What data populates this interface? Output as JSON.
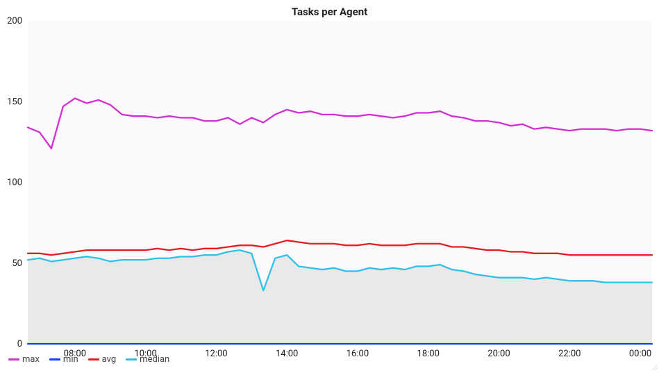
{
  "chart_data": {
    "type": "line",
    "title": "Tasks per Agent",
    "xlabel": "",
    "ylabel": "",
    "ylim": [
      0,
      200
    ],
    "yticks": [
      0,
      50,
      100,
      150,
      200
    ],
    "x": [
      "06:40",
      "07:00",
      "07:20",
      "07:40",
      "08:00",
      "08:20",
      "08:40",
      "09:00",
      "09:20",
      "09:40",
      "10:00",
      "10:20",
      "10:40",
      "11:00",
      "11:20",
      "11:40",
      "12:00",
      "12:20",
      "12:40",
      "13:00",
      "13:20",
      "13:40",
      "14:00",
      "14:20",
      "14:40",
      "15:00",
      "15:20",
      "15:40",
      "16:00",
      "16:20",
      "16:40",
      "17:00",
      "17:20",
      "17:40",
      "18:00",
      "18:20",
      "18:40",
      "19:00",
      "19:20",
      "19:40",
      "20:00",
      "20:20",
      "20:40",
      "21:00",
      "21:20",
      "21:40",
      "22:00",
      "22:20",
      "22:40",
      "23:00",
      "23:20",
      "23:40",
      "00:00",
      "00:10"
    ],
    "xticks": [
      "08:00",
      "10:00",
      "12:00",
      "14:00",
      "16:00",
      "18:00",
      "20:00",
      "22:00",
      "00:00"
    ],
    "series": [
      {
        "name": "max",
        "color": "#d030d0",
        "values": [
          134,
          131,
          121,
          147,
          152,
          149,
          151,
          148,
          142,
          141,
          141,
          140,
          141,
          140,
          140,
          138,
          138,
          140,
          136,
          140,
          137,
          142,
          145,
          143,
          144,
          142,
          142,
          141,
          141,
          142,
          141,
          140,
          141,
          143,
          143,
          144,
          141,
          140,
          138,
          138,
          137,
          135,
          136,
          133,
          134,
          133,
          132,
          133,
          133,
          133,
          132,
          133,
          133,
          132
        ]
      },
      {
        "name": "min",
        "color": "#1040ff",
        "values": [
          0,
          0,
          0,
          0,
          0,
          0,
          0,
          0,
          0,
          0,
          0,
          0,
          0,
          0,
          0,
          0,
          0,
          0,
          0,
          0,
          0,
          0,
          0,
          0,
          0,
          0,
          0,
          0,
          0,
          0,
          0,
          0,
          0,
          0,
          0,
          0,
          0,
          0,
          0,
          0,
          0,
          0,
          0,
          0,
          0,
          0,
          0,
          0,
          0,
          0,
          0,
          0,
          0,
          0
        ]
      },
      {
        "name": "avg",
        "color": "#e02020",
        "values": [
          56,
          56,
          55,
          56,
          57,
          58,
          58,
          58,
          58,
          58,
          58,
          59,
          58,
          59,
          58,
          59,
          59,
          60,
          61,
          61,
          60,
          62,
          64,
          63,
          62,
          62,
          62,
          61,
          61,
          62,
          61,
          61,
          61,
          62,
          62,
          62,
          60,
          60,
          59,
          58,
          58,
          57,
          57,
          56,
          56,
          56,
          55,
          55,
          55,
          55,
          55,
          55,
          55,
          55
        ]
      },
      {
        "name": "median",
        "color": "#30c0e8",
        "values": [
          52,
          53,
          51,
          52,
          53,
          54,
          53,
          51,
          52,
          52,
          52,
          53,
          53,
          54,
          54,
          55,
          55,
          57,
          58,
          56,
          33,
          53,
          55,
          48,
          47,
          46,
          47,
          45,
          45,
          47,
          46,
          47,
          46,
          48,
          48,
          49,
          46,
          45,
          43,
          42,
          41,
          41,
          41,
          40,
          41,
          40,
          39,
          39,
          39,
          38,
          38,
          38,
          38,
          38
        ]
      }
    ],
    "legend_position": "bottom-left"
  }
}
